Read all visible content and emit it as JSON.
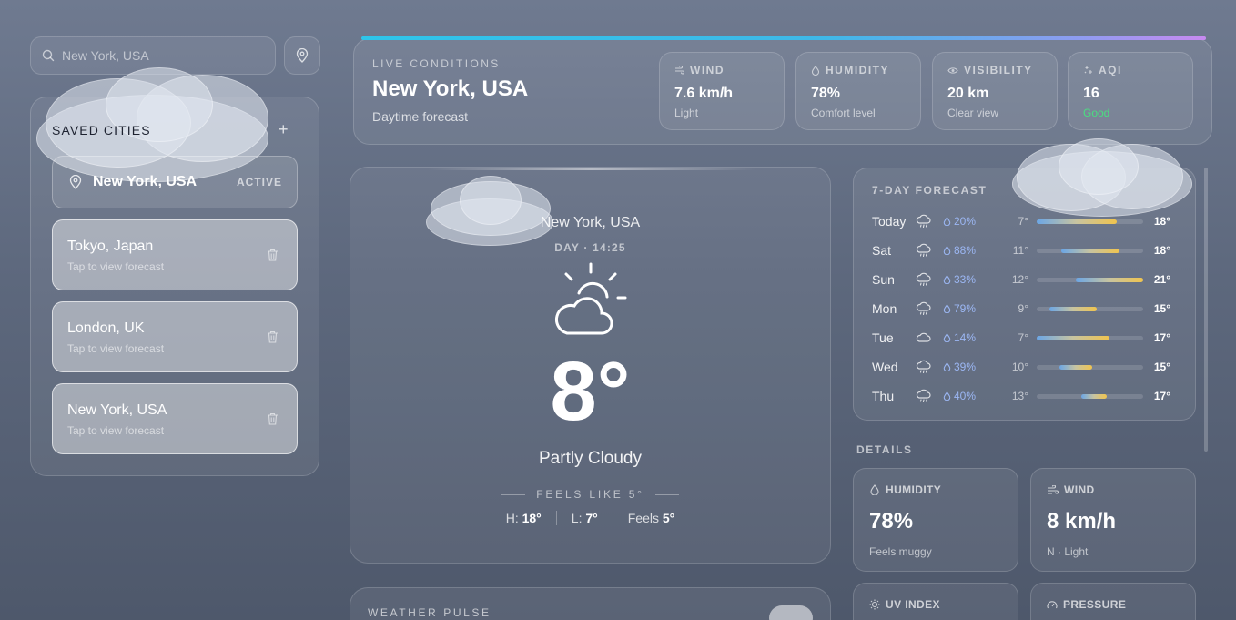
{
  "search": {
    "placeholder": "New York, USA"
  },
  "saved": {
    "title": "SAVED CITIES",
    "add_label": "+",
    "active": {
      "name": "New York, USA",
      "badge": "ACTIVE"
    },
    "cities": [
      {
        "name": "Tokyo, Japan",
        "sub": "Tap to view forecast"
      },
      {
        "name": "London, UK",
        "sub": "Tap to view forecast"
      },
      {
        "name": "New York, USA",
        "sub": "Tap to view forecast"
      }
    ]
  },
  "live": {
    "label": "LIVE CONDITIONS",
    "city": "New York, USA",
    "sub": "Daytime forecast",
    "stats": [
      {
        "label": "WIND",
        "value": "7.6 km/h",
        "sub": "Light",
        "icon": "wind-icon"
      },
      {
        "label": "HUMIDITY",
        "value": "78%",
        "sub": "Comfort level",
        "icon": "droplet-icon"
      },
      {
        "label": "VISIBILITY",
        "value": "20 km",
        "sub": "Clear view",
        "icon": "eye-icon"
      },
      {
        "label": "AQI",
        "value": "16",
        "sub": "Good",
        "icon": "sparkle-icon",
        "sub_color": "#4ade80"
      }
    ]
  },
  "current": {
    "city": "New York, USA",
    "time": "DAY · 14:25",
    "temp": "8°",
    "condition": "Partly Cloudy",
    "feels_label": "FEELS LIKE 5°",
    "high_label": "H:",
    "high": "18°",
    "low_label": "L:",
    "low": "7°",
    "feels_short_label": "Feels",
    "feels": "5°",
    "icon": "partly-cloudy-icon"
  },
  "pulse": {
    "label": "WEATHER PULSE"
  },
  "forecast": {
    "title": "7-DAY FORECAST",
    "days": [
      {
        "day": "Today",
        "icon": "rain-cloud-icon",
        "pop": "20%",
        "lo": "7°",
        "hi": "18°",
        "bar_start": 0.0,
        "bar_end": 0.75
      },
      {
        "day": "Sat",
        "icon": "rain-cloud-icon",
        "pop": "88%",
        "lo": "11°",
        "hi": "18°",
        "bar_start": 0.23,
        "bar_end": 0.78
      },
      {
        "day": "Sun",
        "icon": "rain-cloud-icon",
        "pop": "33%",
        "lo": "12°",
        "hi": "21°",
        "bar_start": 0.37,
        "bar_end": 1.0
      },
      {
        "day": "Mon",
        "icon": "rain-cloud-icon",
        "pop": "79%",
        "lo": "9°",
        "hi": "15°",
        "bar_start": 0.12,
        "bar_end": 0.56
      },
      {
        "day": "Tue",
        "icon": "cloud-icon",
        "pop": "14%",
        "lo": "7°",
        "hi": "17°",
        "bar_start": 0.0,
        "bar_end": 0.68
      },
      {
        "day": "Wed",
        "icon": "rain-cloud-icon",
        "pop": "39%",
        "lo": "10°",
        "hi": "15°",
        "bar_start": 0.21,
        "bar_end": 0.52
      },
      {
        "day": "Thu",
        "icon": "rain-cloud-icon",
        "pop": "40%",
        "lo": "13°",
        "hi": "17°",
        "bar_start": 0.42,
        "bar_end": 0.66
      }
    ]
  },
  "details": {
    "title": "DETAILS",
    "cards": [
      {
        "label": "HUMIDITY",
        "value": "78%",
        "sub": "Feels muggy",
        "icon": "droplet-icon"
      },
      {
        "label": "WIND",
        "value": "8 km/h",
        "sub": "N · Light",
        "icon": "wind-icon"
      },
      {
        "label": "UV INDEX",
        "value": "",
        "sub": "",
        "icon": "sun-icon"
      },
      {
        "label": "PRESSURE",
        "value": "",
        "sub": "",
        "icon": "gauge-icon"
      }
    ]
  }
}
